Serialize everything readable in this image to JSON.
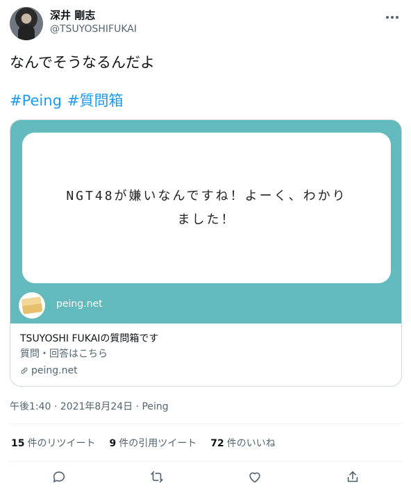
{
  "author": {
    "display_name": "深井 剛志",
    "handle": "@TSUYOSHIFUKAI",
    "avatar_icon": "user-avatar"
  },
  "tweet": {
    "text": "なんでそうなるんだよ",
    "hashtags": [
      "#Peing",
      "#質問箱"
    ]
  },
  "card": {
    "image_text": "NGT48が嫌いなんですね！よーく、わかりました！",
    "site_label": "peing.net",
    "title": "TSUYOSHI FUKAIの質問箱です",
    "description": "質問・回答はこちら",
    "link": "peing.net",
    "colors": {
      "background": "#63babc"
    }
  },
  "timestamp": "午後1:40 · 2021年8月24日 · Peing",
  "stats": {
    "retweets_count": "15",
    "retweets_label": "件のリツイート",
    "quotes_count": "9",
    "quotes_label": "件の引用ツイート",
    "likes_count": "72",
    "likes_label": "件のいいね"
  },
  "actions": [
    "reply-icon",
    "retweet-icon",
    "like-icon",
    "share-icon"
  ]
}
